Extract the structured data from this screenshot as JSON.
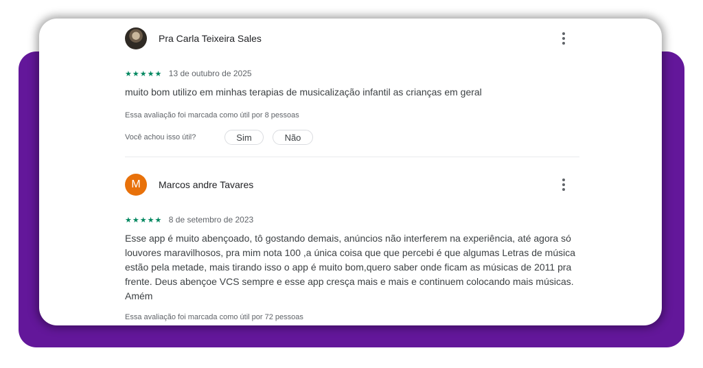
{
  "reviews": [
    {
      "author": "Pra Carla Teixeira Sales",
      "avatar_type": "photo",
      "stars": "★★★★★",
      "rating": 5,
      "date": "13 de outubro de 2025",
      "text": "muito bom utilizo em minhas terapias de musicalização infantil as crianças em geral",
      "helpful_text": "Essa avaliação foi marcada como útil por 8 pessoas",
      "feedback_question": "Você achou isso útil?",
      "yes_label": "Sim",
      "no_label": "Não"
    },
    {
      "author": "Marcos andre Tavares",
      "avatar_type": "letter",
      "avatar_letter": "M",
      "avatar_color": "#e8710a",
      "stars": "★★★★★",
      "rating": 5,
      "date": "8 de setembro de 2023",
      "text": "Esse app é muito abençoado, tô gostando demais, anúncios não interferem na experiência, até agora só louvores maravilhosos, pra mim nota 100 ,a única coisa que que percebi é que algumas Letras de música estão pela metade, mais tirando isso o app é muito bom,quero saber onde ficam as músicas de 2011 pra frente. Deus abençoe VCS sempre e esse app cresça mais e mais e continuem colocando mais músicas. Amém",
      "helpful_text": "Essa avaliação foi marcada como útil por 72 pessoas"
    }
  ],
  "colors": {
    "background_accent": "#63179a",
    "star_color": "#01875f",
    "card": "#ffffff"
  },
  "icons": {
    "more_options": "more-vert-icon"
  }
}
